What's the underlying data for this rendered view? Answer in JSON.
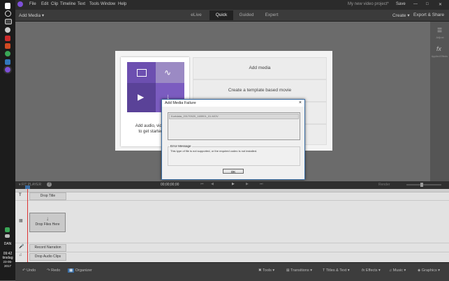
{
  "taskbar": {
    "icons": [
      {
        "name": "windows-start-icon",
        "color": "#ffffff"
      },
      {
        "name": "search-icon",
        "color": "#dddddd"
      },
      {
        "name": "task-view-icon",
        "color": "#dddddd"
      },
      {
        "name": "steam-icon",
        "color": "#cccccc"
      },
      {
        "name": "acrobat-icon",
        "color": "#cc2b2b"
      },
      {
        "name": "powerpoint-icon",
        "color": "#d04a22"
      },
      {
        "name": "chrome-icon",
        "color": "#3aa757"
      },
      {
        "name": "edge-icon",
        "color": "#3277bc"
      },
      {
        "name": "file-explorer-icon",
        "color": "#f0c040"
      },
      {
        "name": "premiere-elements-icon",
        "color": "#7d4fd8"
      }
    ],
    "lang": "DAN",
    "time": "09:42",
    "day": "tirsdag",
    "date": "23-05-2017"
  },
  "menubar": {
    "items": [
      "File",
      "Edit",
      "Clip",
      "Timeline",
      "Text",
      "Tools",
      "Window",
      "Help"
    ],
    "project": "My new video project*",
    "save": "Save"
  },
  "modebar": {
    "add_media": "Add Media",
    "tabs": [
      "eLive",
      "Quick",
      "Guided",
      "Expert"
    ],
    "active_tab": "Quick",
    "create": "Create",
    "export": "Export & Share"
  },
  "right_panel": {
    "adjust": "Adjust",
    "effects": "Applied Effects"
  },
  "add_media_panel": {
    "header": "Add media",
    "template_option": "Create a template based movie",
    "caption_line1": "Add audio, video and",
    "caption_line2": "to get started with"
  },
  "dialog": {
    "title": "Add Media Failure",
    "close": "×",
    "file": "Kortdata_20170520_165901_01.MOV",
    "error_label": "Error Message",
    "error_text": "This type of file is not supported, or the required codec is not installed.",
    "ok": "OK"
  },
  "timeline_toolbar": {
    "label": "FIT PLAYER",
    "timecode": "00;00;00;00",
    "render": "Render"
  },
  "timeline": {
    "tracks": [
      {
        "icon": "title-icon",
        "label": "Drop Title"
      },
      {
        "icon": "video-icon",
        "label": "Drop Files Here"
      },
      {
        "icon": "narration-icon",
        "label": "Record Narration"
      },
      {
        "icon": "audio-icon",
        "label": "Drop Audio Clips"
      }
    ]
  },
  "actionbar": {
    "left": [
      "Undo",
      "Redo",
      "Organizer"
    ],
    "right": [
      "Tools",
      "Transitions",
      "Titles & Text",
      "Effects",
      "Music",
      "Graphics"
    ]
  },
  "colors": {
    "accent": "#7d4fd8",
    "playhead": "#dd3333",
    "dialog_border": "#3a6ea5"
  }
}
